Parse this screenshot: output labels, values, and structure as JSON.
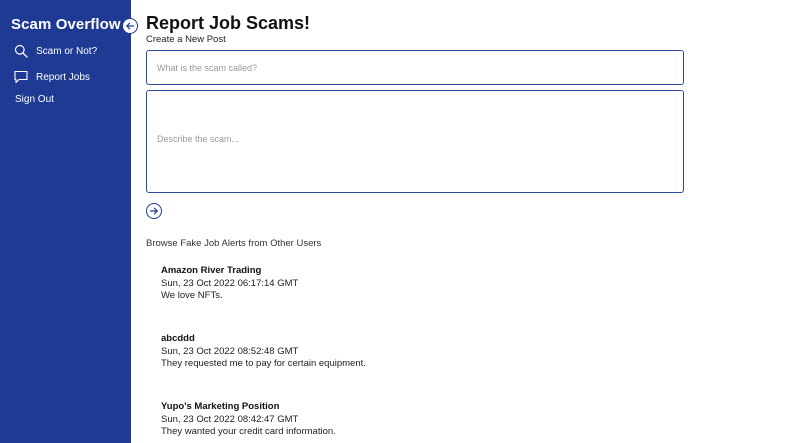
{
  "sidebar": {
    "brand": "Scam Overflow",
    "nav": [
      {
        "label": "Scam or Not?",
        "icon": "search-icon"
      },
      {
        "label": "Report Jobs",
        "icon": "chat-bubble-icon"
      }
    ],
    "sign_out": "Sign Out",
    "collapse_icon": "arrow-left-icon"
  },
  "main": {
    "title": "Report Job Scams!",
    "subtitle": "Create a New Post",
    "title_placeholder": "What is the scam called?",
    "description_placeholder": "Describe the scam...",
    "submit_icon": "arrow-right-icon",
    "browse_heading": "Browse Fake Job Alerts from Other Users",
    "posts": [
      {
        "title": "Amazon River Trading",
        "date": "Sun, 23 Oct 2022 06:17:14 GMT",
        "body": "We love NFTs."
      },
      {
        "title": "abcddd",
        "date": "Sun, 23 Oct 2022 08:52:48 GMT",
        "body": "They requested me to pay for certain equipment."
      },
      {
        "title": "Yupo's Marketing Position",
        "date": "Sun, 23 Oct 2022 08:42:47 GMT",
        "body": "They wanted your credit card information."
      }
    ]
  },
  "colors": {
    "sidebar_bg": "#1f3a93",
    "accent": "#2a4aa0"
  }
}
